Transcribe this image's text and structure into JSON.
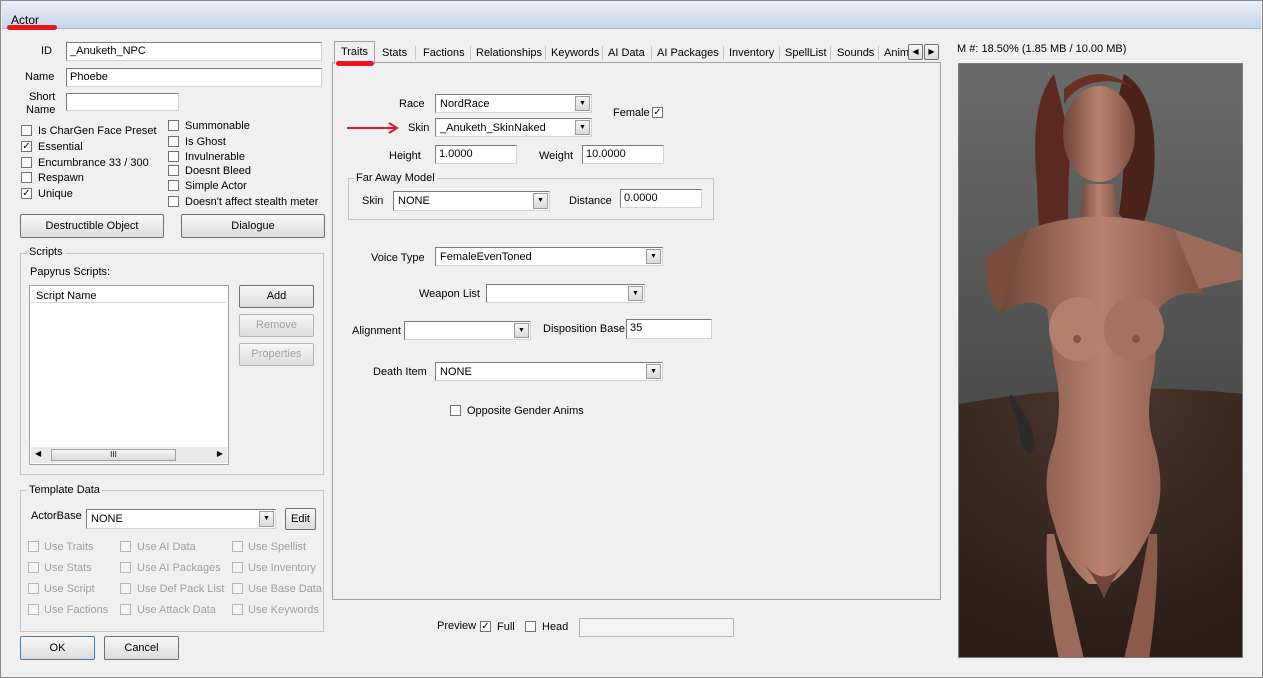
{
  "window": {
    "title": "Actor"
  },
  "identity": {
    "id_label": "ID",
    "id_value": "_Anuketh_NPC",
    "name_label": "Name",
    "name_value": "Phoebe",
    "short_name_label_1": "Short",
    "short_name_label_2": "Name",
    "short_name_value": ""
  },
  "flags_left": [
    {
      "label": "Is CharGen Face Preset",
      "checked": false
    },
    {
      "label": "Essential",
      "checked": true
    },
    {
      "label": "Encumbrance 33 / 300",
      "checked": false
    },
    {
      "label": "Respawn",
      "checked": false
    },
    {
      "label": "Unique",
      "checked": true
    }
  ],
  "flags_right": [
    {
      "label": "Summonable",
      "checked": false
    },
    {
      "label": "Is Ghost",
      "checked": false
    },
    {
      "label": "Invulnerable",
      "checked": false
    },
    {
      "label": "Doesnt Bleed",
      "checked": false
    },
    {
      "label": "Simple Actor",
      "checked": false
    },
    {
      "label": "Doesn't affect stealth meter",
      "checked": false
    }
  ],
  "buttons": {
    "destructible": "Destructible Object",
    "dialogue": "Dialogue",
    "ok": "OK",
    "cancel": "Cancel"
  },
  "scripts": {
    "group_title": "Scripts",
    "papyrus_label": "Papyrus Scripts:",
    "column_header": "Script Name",
    "add": "Add",
    "remove": "Remove",
    "properties": "Properties",
    "scroll_thumb": "III"
  },
  "template": {
    "group_title": "Template Data",
    "actorbase_label": "ActorBase",
    "actorbase_value": "NONE",
    "edit": "Edit",
    "options": [
      "Use Traits",
      "Use AI Data",
      "Use Spellist",
      "Use Stats",
      "Use AI Packages",
      "Use Inventory",
      "Use Script",
      "Use Def Pack List",
      "Use Base Data",
      "Use Factions",
      "Use Attack Data",
      "Use Keywords"
    ]
  },
  "tabs": [
    "Traits",
    "Stats",
    "Factions",
    "Relationships",
    "Keywords",
    "AI Data",
    "AI Packages",
    "Inventory",
    "SpellList",
    "Sounds",
    "Anim"
  ],
  "traits": {
    "race_label": "Race",
    "race_value": "NordRace",
    "female_label": "Female",
    "female_checked": true,
    "skin_label": "Skin",
    "skin_value": "_Anuketh_SkinNaked",
    "height_label": "Height",
    "height_value": "1.0000",
    "weight_label": "Weight",
    "weight_value": "10.0000",
    "far_away_title": "Far Away Model",
    "far_skin_label": "Skin",
    "far_skin_value": "NONE",
    "distance_label": "Distance",
    "distance_value": "0.0000",
    "voice_label": "Voice Type",
    "voice_value": "FemaleEvenToned",
    "weapon_label": "Weapon List",
    "weapon_value": "",
    "alignment_label": "Alignment",
    "alignment_value": "",
    "disposition_label": "Disposition Base",
    "disposition_value": "35",
    "death_label": "Death Item",
    "death_value": "NONE",
    "opposite_label": "Opposite Gender Anims",
    "opposite_checked": false
  },
  "preview": {
    "label": "Preview",
    "full_label": "Full",
    "full_checked": true,
    "head_label": "Head",
    "head_checked": false,
    "memory_text": "M #: 18.50% (1.85 MB / 10.00 MB)"
  },
  "colors": {
    "annotation_red": "#e8141e",
    "preview_sky": "#5b5b5b",
    "preview_ground": "#3a2a22",
    "skin": "#b07a6a"
  }
}
